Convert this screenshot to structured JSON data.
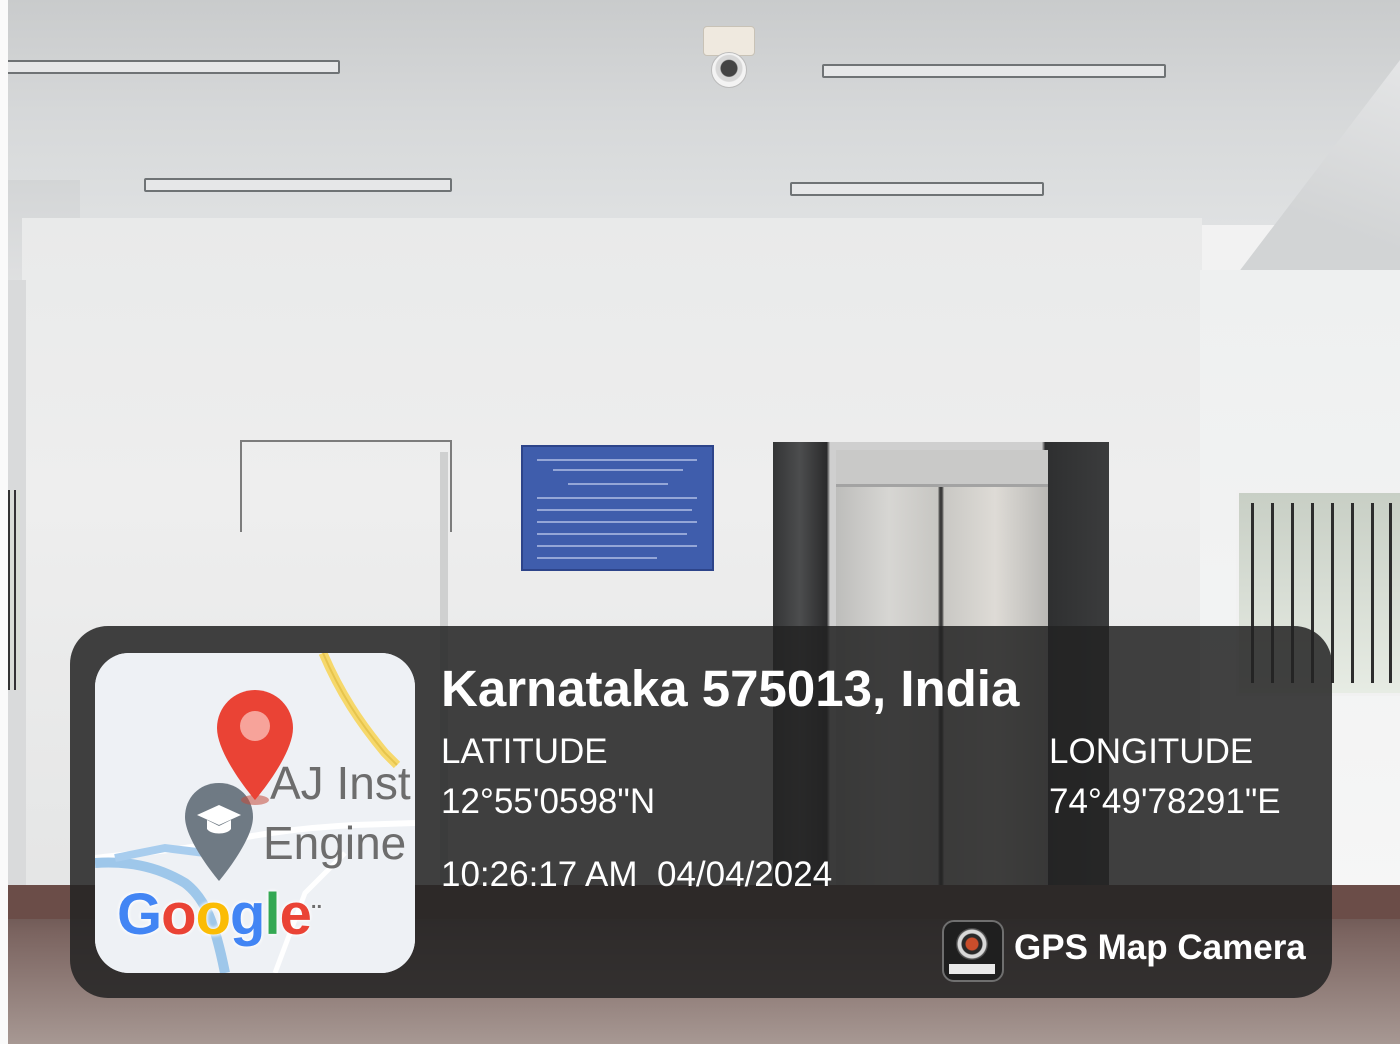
{
  "overlay": {
    "location": "Karnataka 575013, India",
    "latitude_label": "LATITUDE",
    "latitude_value": "12°55'0598\"N",
    "longitude_label": "LONGITUDE",
    "longitude_value": "74°49'78291\"E",
    "time": "10:26:17 AM",
    "date": "04/04/2024",
    "app_name": "GPS Map Camera"
  },
  "map": {
    "place_line1": "AJ Inst",
    "place_line2": "Engine",
    "logo": {
      "letters": [
        "G",
        "o",
        "o",
        "g",
        "l",
        "e"
      ],
      "dots": "··"
    },
    "icons": {
      "pin": "location-pin-icon",
      "school": "graduation-cap-icon"
    }
  },
  "colors": {
    "overlay_bg": "#232323",
    "pin_red": "#ea4335",
    "google_blue": "#4285f4",
    "google_red": "#ea4335",
    "google_yellow": "#fbbc05",
    "google_green": "#34a853"
  }
}
